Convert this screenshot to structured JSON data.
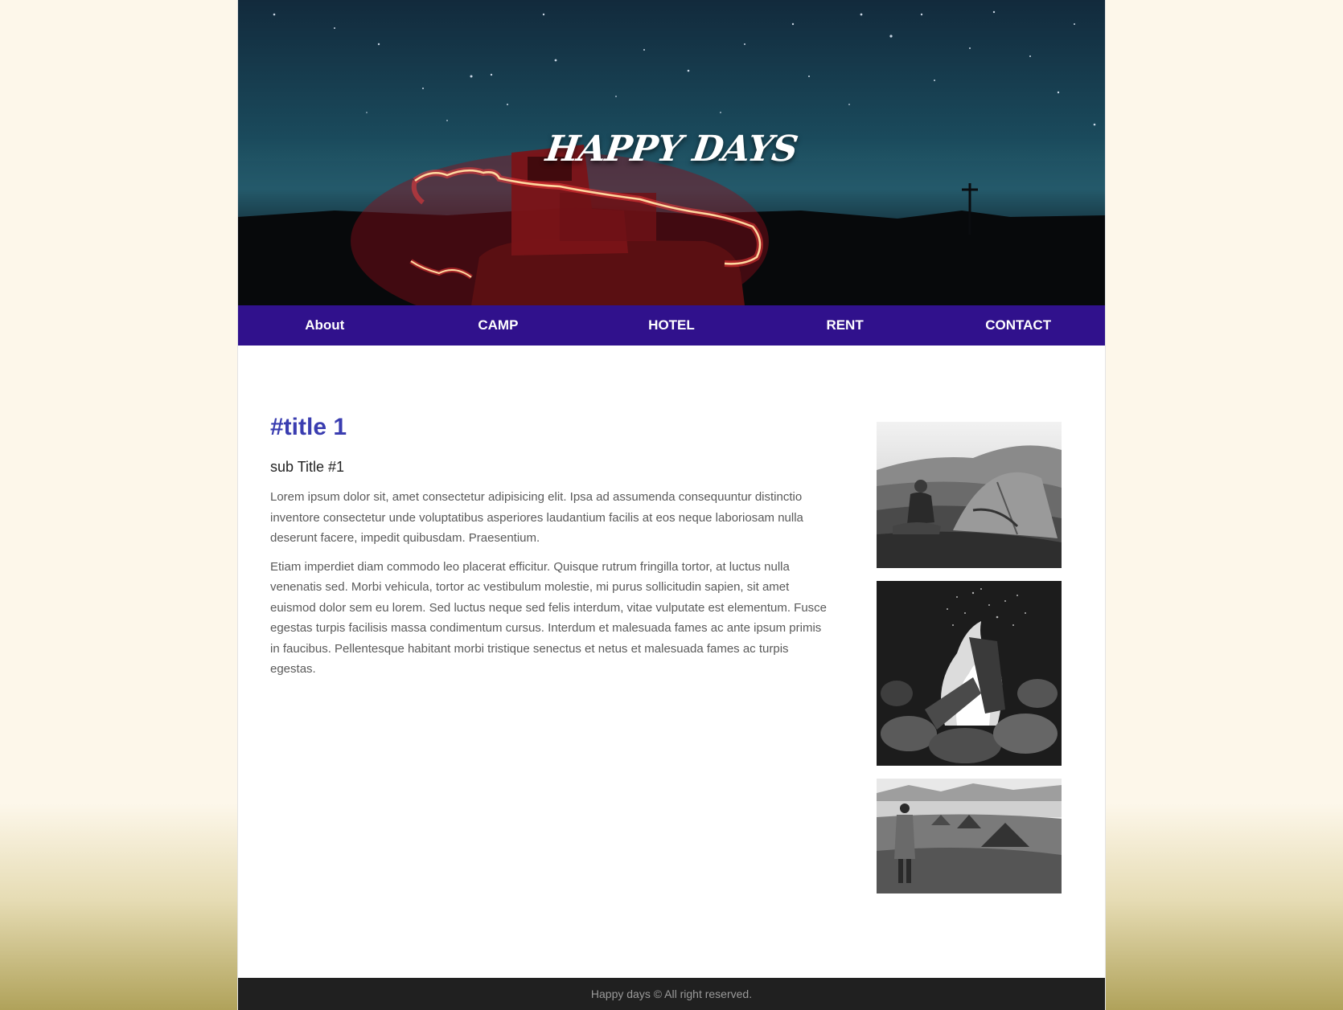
{
  "header": {
    "title": "HAPPY DAYS"
  },
  "nav": {
    "items": [
      {
        "label": "About"
      },
      {
        "label": "CAMP"
      },
      {
        "label": "HOTEL"
      },
      {
        "label": "RENT"
      },
      {
        "label": "CONTACT"
      }
    ]
  },
  "article": {
    "title": "#title 1",
    "subtitle": "sub Title #1",
    "paragraphs": [
      "Lorem ipsum dolor sit, amet consectetur adipisicing elit. Ipsa ad assumenda consequuntur distinctio inventore consectetur unde voluptatibus asperiores laudantium facilis at eos neque laboriosam nulla deserunt facere, impedit quibusdam. Praesentium.",
      "Etiam imperdiet diam commodo leo placerat efficitur. Quisque rutrum fringilla tortor, at luctus nulla venenatis sed. Morbi vehicula, tortor ac vestibulum molestie, mi purus sollicitudin sapien, sit amet euismod dolor sem eu lorem. Sed luctus neque sed felis interdum, vitae vulputate est elementum. Fusce egestas turpis facilisis massa condimentum cursus. Interdum et malesuada fames ac ante ipsum primis in faucibus. Pellentesque habitant morbi tristique senectus et netus et malesuada fames ac turpis egestas."
    ]
  },
  "gallery": {
    "photos": [
      "tent-photo",
      "campfire-photo",
      "camp-field-photo"
    ]
  },
  "footer": {
    "text": "Happy days © All right reserved."
  },
  "colors": {
    "nav_background": "#30118c",
    "title_accent": "#3a3db0",
    "footer_background": "#202020",
    "page_background": "#fdf7ea"
  }
}
